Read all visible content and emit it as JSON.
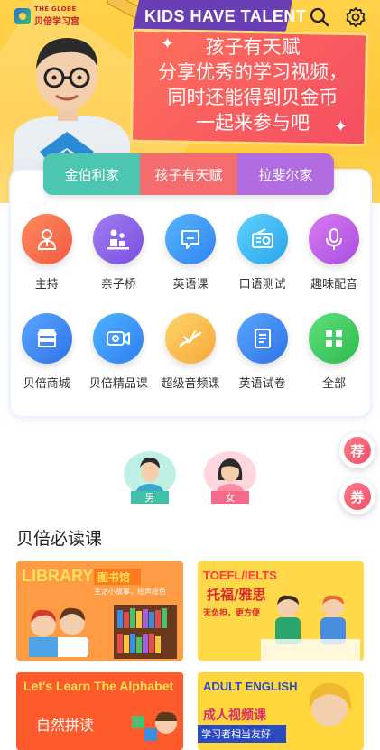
{
  "app": {
    "logo_en": "THE GLOBE",
    "logo_zh": "贝倍学习宫"
  },
  "header": {
    "icons": [
      "search-icon",
      "settings-icon"
    ]
  },
  "banner": {
    "tag": "KIDS HAVE TALENT",
    "lines": [
      "孩子有天赋",
      "分享优秀的学习视频，",
      "同时还能得到贝金币",
      "一起来参与吧"
    ]
  },
  "tabs": [
    {
      "label": "金伯利家",
      "color": "#4cc6b0"
    },
    {
      "label": "孩子有天赋",
      "color": "#f36d6e"
    },
    {
      "label": "拉斐尔家",
      "color": "#b06ce0"
    }
  ],
  "grid": [
    {
      "label": "主持",
      "icon": "host-icon"
    },
    {
      "label": "亲子桥",
      "icon": "bridge-icon"
    },
    {
      "label": "英语课",
      "icon": "chat-icon"
    },
    {
      "label": "口语测试",
      "icon": "radio-icon"
    },
    {
      "label": "趣味配音",
      "icon": "microphone-icon"
    },
    {
      "label": "贝倍商城",
      "icon": "shop-icon"
    },
    {
      "label": "贝倍精品课",
      "icon": "video-icon"
    },
    {
      "label": "超级音频课",
      "icon": "audio-icon"
    },
    {
      "label": "英语试卷",
      "icon": "paper-icon"
    },
    {
      "label": "全部",
      "icon": "grid-icon"
    }
  ],
  "side_buttons": [
    "荐",
    "券"
  ],
  "gender": {
    "male": "男",
    "female": "女"
  },
  "section": {
    "title": "贝倍必读课"
  },
  "courses": [
    {
      "title": "LIBRARY",
      "subtitle": "图书馆",
      "desc": "主活小故事，绘声绘色"
    },
    {
      "title": "TOEFL/IELTS",
      "subtitle": "托福/雅思",
      "desc": "无负担，更方便"
    },
    {
      "title": "Let's Learn The Alphabet",
      "subtitle": "自然拼读"
    },
    {
      "title": "ADULT ENGLISH",
      "subtitle": "成人视频课",
      "desc": "学习者相当友好"
    }
  ]
}
